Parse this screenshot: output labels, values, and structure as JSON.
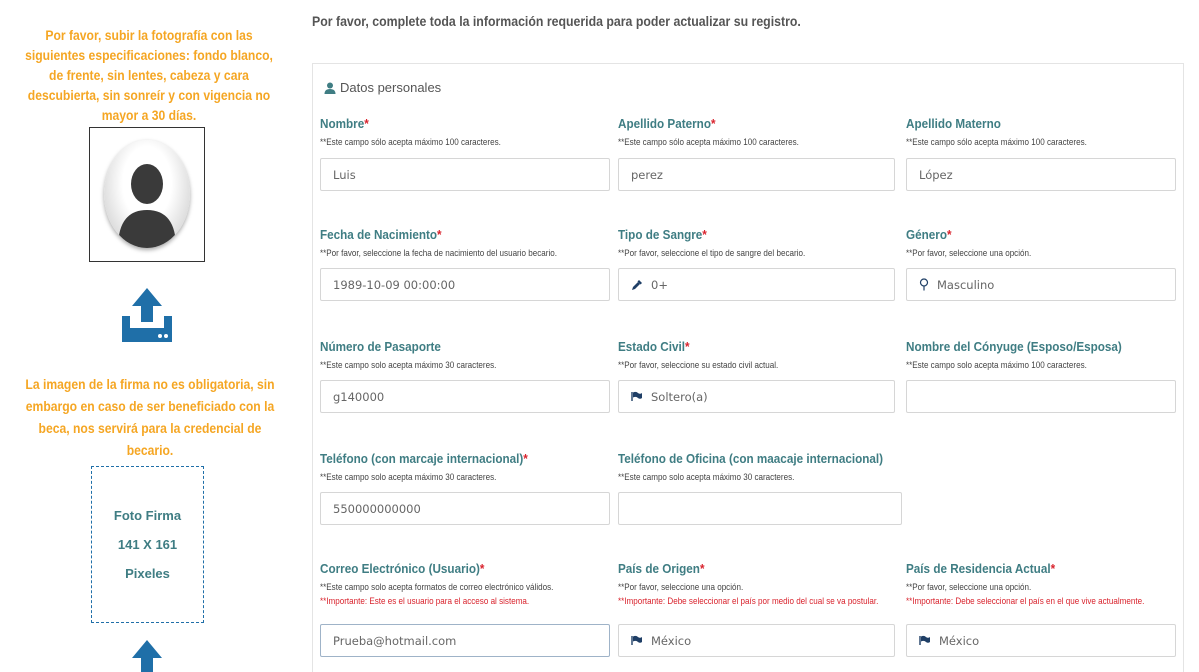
{
  "sidebar": {
    "photo_instructions": "Por favor, subir la fotografía con las siguientes especificaciones: fondo blanco, de frente, sin lentes, cabeza y cara descubierta, sin sonreír y con vigencia no mayor a 30 días.",
    "signature_instructions": "La imagen de la firma no es obligatoria, sin embargo en caso de ser beneficiado con la beca, nos servirá para la credencial de becario.",
    "signature_box": {
      "line1": "Foto Firma",
      "line2": "141 X 161",
      "line3": "Pixeles"
    }
  },
  "header": {
    "text": "Por favor, complete toda la información requerida para poder actualizar su registro."
  },
  "panel": {
    "title": "Datos personales"
  },
  "fields": {
    "nombre": {
      "label": "Nombre",
      "req": "*",
      "hint": "**Este campo sólo acepta máximo 100 caracteres.",
      "value": "Luis"
    },
    "apellido_paterno": {
      "label": "Apellido Paterno",
      "req": "*",
      "hint": "**Este campo sólo acepta máximo 100 caracteres.",
      "value": "perez"
    },
    "apellido_materno": {
      "label": "Apellido Materno",
      "hint": "**Este campo sólo acepta máximo 100 caracteres.",
      "value": "López"
    },
    "fecha_nacimiento": {
      "label": "Fecha de Nacimiento",
      "req": "*",
      "hint": "**Por favor, seleccione la fecha de nacimiento del usuario becario.",
      "value": "1989-10-09 00:00:00"
    },
    "tipo_sangre": {
      "label": "Tipo de Sangre",
      "req": "*",
      "hint": "**Por favor, seleccione el tipo de sangre del becario.",
      "value": "0+",
      "icon": "eyedropper-icon"
    },
    "genero": {
      "label": "Género",
      "req": "*",
      "hint": "**Por favor, seleccione una opción.",
      "value": "Masculino",
      "icon": "male-icon"
    },
    "pasaporte": {
      "label": "Número de Pasaporte",
      "hint": "**Este campo solo acepta máximo 30 caracteres.",
      "value": "g140000"
    },
    "estado_civil": {
      "label": "Estado Civil",
      "req": "*",
      "hint": "**Por favor, seleccione su estado civil actual.",
      "value": "Soltero(a)",
      "icon": "flag-icon"
    },
    "conyuge": {
      "label": "Nombre del Cónyuge (Esposo/Esposa)",
      "hint": "**Este campo solo acepta máximo 100 caracteres.",
      "value": ""
    },
    "telefono": {
      "label": "Teléfono (con marcaje internacional)",
      "req": "*",
      "hint": "**Este campo solo acepta máximo 30 caracteres.",
      "value": "550000000000"
    },
    "telefono_oficina": {
      "label": "Teléfono de Oficina (con maacaje internacional)",
      "hint": "**Este campo solo acepta máximo 30 caracteres.",
      "value": ""
    },
    "correo": {
      "label": "Correo Electrónico (Usuario)",
      "req": "*",
      "hint": "**Este campo solo acepta formatos de correo electrónico válidos.",
      "warn": "**Importante: Este es el usuario para el acceso al sistema.",
      "value": "Prueba@hotmail.com"
    },
    "pais_origen": {
      "label": "País de Origen",
      "req": "*",
      "hint": "**Por favor, seleccione una opción.",
      "warn": "**Importante: Debe seleccionar el país por medio del cual se va postular.",
      "value": "México",
      "icon": "flag-icon"
    },
    "pais_residencia": {
      "label": "País de Residencia Actual",
      "req": "*",
      "hint": "**Por favor, seleccione una opción.",
      "warn": "**Importante: Debe seleccionar el país en el que vive actualmente.",
      "value": "México",
      "icon": "flag-icon"
    }
  },
  "colors": {
    "label": "#3f7d83",
    "required": "#d9232d",
    "instructions": "#f5a623",
    "icon": "#1f3f66"
  }
}
